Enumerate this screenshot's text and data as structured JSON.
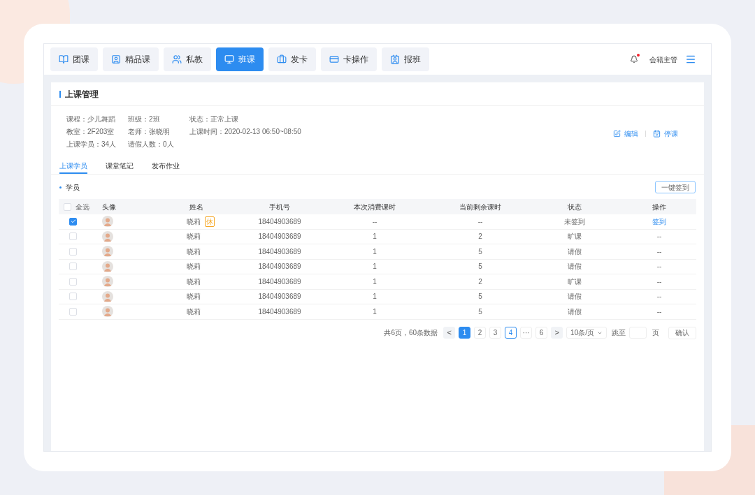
{
  "nav": {
    "tabs": [
      {
        "label": "团课",
        "selected": false
      },
      {
        "label": "精品课",
        "selected": false
      },
      {
        "label": "私教",
        "selected": false
      },
      {
        "label": "班课",
        "selected": true
      },
      {
        "label": "发卡",
        "selected": false
      },
      {
        "label": "卡操作",
        "selected": false
      },
      {
        "label": "报班",
        "selected": false
      }
    ],
    "notifications": {
      "unread": true
    },
    "user": "会籍主管"
  },
  "page": {
    "title": "上课管理",
    "info": [
      {
        "label": "课程：",
        "value": "少儿舞蹈"
      },
      {
        "label": "班级：",
        "value": "2班"
      },
      {
        "label": "状态：",
        "value": "正常上课"
      },
      {
        "label": "教室：",
        "value": "2F203室"
      },
      {
        "label": "老师：",
        "value": "张晓明"
      },
      {
        "label": "上课时间：",
        "value": "2020-02-13 06:50~08:50"
      },
      {
        "label": "上课学员：",
        "value": "34人"
      },
      {
        "label": "请假人数：",
        "value": "0人"
      }
    ],
    "actions": [
      "编辑",
      "停课"
    ],
    "tabs": [
      {
        "label": "上课学员",
        "selected": true
      },
      {
        "label": "课堂笔记",
        "selected": false
      },
      {
        "label": "发布作业",
        "selected": false
      }
    ],
    "section": "学员",
    "bulk_button": "一键签到",
    "table": {
      "select_all": {
        "label": "全选",
        "checked": false
      },
      "columns": [
        "头像",
        "姓名",
        "手机号",
        "本次消费课时",
        "当前剩余课时",
        "状态",
        "操作"
      ],
      "rows": [
        {
          "checked": true,
          "name": "晓莉",
          "badge": "休",
          "phone": "18404903689",
          "used": "--",
          "remaining": "--",
          "status": "未签到",
          "action": {
            "kind": "link",
            "text": "签到"
          }
        },
        {
          "checked": false,
          "name": "晓莉",
          "phone": "18404903689",
          "used": "1",
          "remaining": "2",
          "status": "旷课",
          "action": {
            "kind": "text",
            "text": "--"
          }
        },
        {
          "checked": false,
          "name": "晓莉",
          "phone": "18404903689",
          "used": "1",
          "remaining": "5",
          "status": "请假",
          "action": {
            "kind": "text",
            "text": "--"
          }
        },
        {
          "checked": false,
          "name": "晓莉",
          "phone": "18404903689",
          "used": "1",
          "remaining": "5",
          "status": "请假",
          "action": {
            "kind": "text",
            "text": "--"
          }
        },
        {
          "checked": false,
          "name": "晓莉",
          "phone": "18404903689",
          "used": "1",
          "remaining": "2",
          "status": "旷课",
          "action": {
            "kind": "text",
            "text": "--"
          }
        },
        {
          "checked": false,
          "name": "晓莉",
          "phone": "18404903689",
          "used": "1",
          "remaining": "5",
          "status": "请假",
          "action": {
            "kind": "text",
            "text": "--"
          }
        },
        {
          "checked": false,
          "name": "晓莉",
          "phone": "18404903689",
          "used": "1",
          "remaining": "5",
          "status": "请假",
          "action": {
            "kind": "text",
            "text": "--"
          }
        }
      ]
    },
    "pagination": {
      "summary": "共6页，60条数据",
      "prev": "<",
      "next": ">",
      "pages": [
        {
          "label": "1",
          "selected": true,
          "focused": false
        },
        {
          "label": "2",
          "selected": false,
          "focused": false
        },
        {
          "label": "3",
          "selected": false,
          "focused": false
        },
        {
          "label": "4",
          "selected": false,
          "focused": true
        },
        {
          "label": "···",
          "selected": false,
          "focused": false
        },
        {
          "label": "6",
          "selected": false,
          "focused": false
        }
      ],
      "page_size": "10条/页",
      "jump_label": "跳至",
      "page_unit": "页",
      "confirm": "确认"
    }
  }
}
